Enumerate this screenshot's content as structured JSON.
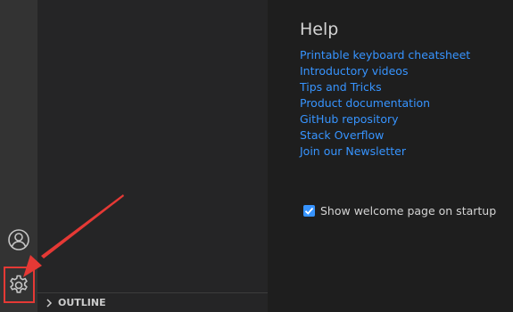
{
  "activity_bar": {
    "icons": [
      "account-icon",
      "gear-icon"
    ]
  },
  "sidebar": {
    "outline_label": "OUTLINE"
  },
  "welcome": {
    "help_title": "Help",
    "help_links": [
      "Printable keyboard cheatsheet",
      "Introductory videos",
      "Tips and Tricks",
      "Product documentation",
      "GitHub repository",
      "Stack Overflow",
      "Join our Newsletter"
    ],
    "show_on_startup_label": "Show welcome page on startup",
    "show_on_startup_checked": true
  },
  "annotation": {
    "color": "#e53935"
  },
  "colors": {
    "link": "#3794ff",
    "activity_bar": "#333333",
    "sidebar": "#252526",
    "editor": "#1e1e1e"
  }
}
